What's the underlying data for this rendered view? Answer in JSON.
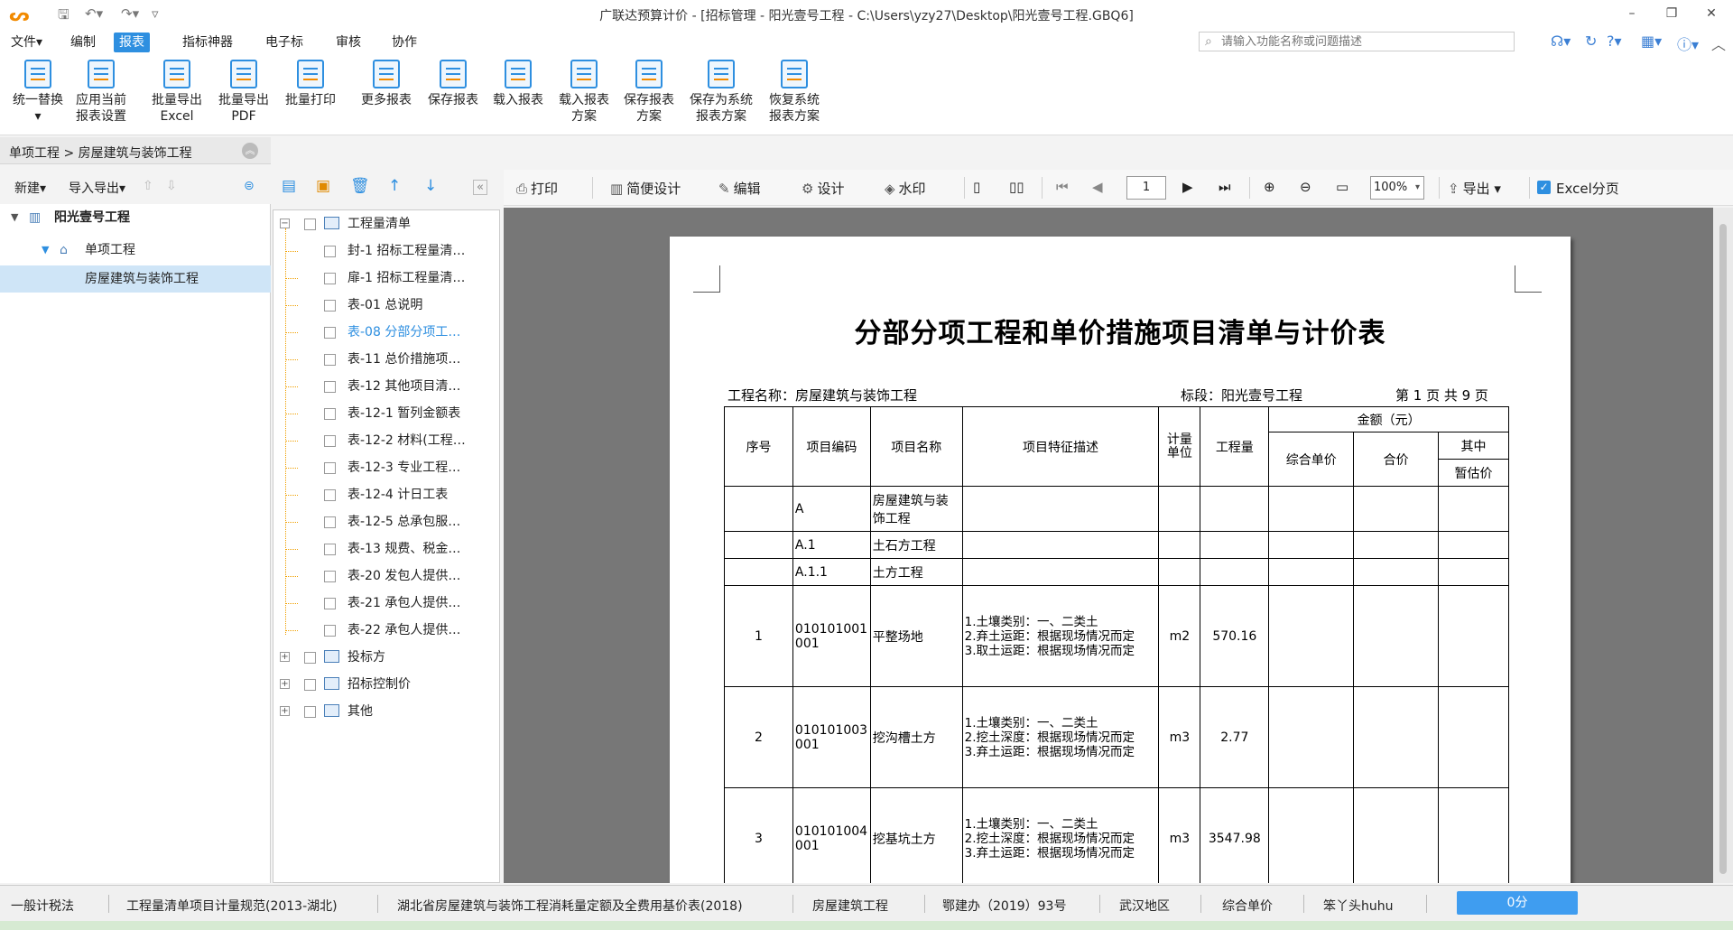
{
  "window": {
    "title": "广联达预算计价 - [招标管理 - 阳光壹号工程 - C:\\Users\\yzy27\\Desktop\\阳光壹号工程.GBQ6]",
    "minimize": "–",
    "restore": "❐",
    "close": "✕"
  },
  "menu": {
    "items": [
      "文件▾",
      "编制",
      "报表",
      "指标神器",
      "电子标",
      "审核",
      "协作"
    ],
    "active_index": 2
  },
  "search": {
    "placeholder": "请输入功能名称或问题描述"
  },
  "ribbon": {
    "buttons": [
      {
        "l1": "统一替换",
        "l2": "▾"
      },
      {
        "l1": "应用当前",
        "l2": "报表设置"
      },
      {
        "l1": "批量导出",
        "l2": "Excel"
      },
      {
        "l1": "批量导出",
        "l2": "PDF"
      },
      {
        "l1": "批量打印",
        "l2": ""
      },
      {
        "l1": "更多报表",
        "l2": ""
      },
      {
        "l1": "保存报表",
        "l2": ""
      },
      {
        "l1": "载入报表",
        "l2": ""
      },
      {
        "l1": "载入报表",
        "l2": "方案"
      },
      {
        "l1": "保存报表",
        "l2": "方案"
      },
      {
        "l1": "保存为系统",
        "l2": "报表方案"
      },
      {
        "l1": "恢复系统",
        "l2": "报表方案"
      }
    ]
  },
  "breadcrumb": "单项工程 > 房屋建筑与装饰工程",
  "left_toolbar": {
    "new": "新建▾",
    "import_export": "导入导出▾"
  },
  "left_tree": {
    "root": "阳光壹号工程",
    "child": "单项工程",
    "leaf": "房屋建筑与装饰工程"
  },
  "report_tree": {
    "group1": "工程量清单",
    "items": [
      "封-1 招标工程量清…",
      "扉-1 招标工程量清…",
      "表-01 总说明",
      "表-08 分部分项工…",
      "表-11 总价措施项…",
      "表-12 其他项目清…",
      "表-12-1 暂列金额表",
      "表-12-2 材料(工程…",
      "表-12-3 专业工程…",
      "表-12-4 计日工表",
      "表-12-5 总承包服…",
      "表-13 规费、税金…",
      "表-20 发包人提供…",
      "表-21 承包人提供…",
      "表-22 承包人提供…"
    ],
    "selected_index": 3,
    "groups": [
      "投标方",
      "招标控制价",
      "其他"
    ]
  },
  "viewer_toolbar": {
    "print": "打印",
    "easy_design": "简便设计",
    "edit": "编辑",
    "design": "设计",
    "watermark": "水印",
    "page": "1",
    "zoom": "100%",
    "export": "导出",
    "excel_paging": "Excel分页"
  },
  "report": {
    "title": "分部分项工程和单价措施项目清单与计价表",
    "project_name": "工程名称：房屋建筑与装饰工程",
    "section": "标段：阳光壹号工程",
    "page_info": "第 1 页  共 9 页",
    "headers": {
      "seq": "序号",
      "code": "项目编码",
      "name": "项目名称",
      "desc": "项目特征描述",
      "unit": "计量单位",
      "qty": "工程量",
      "amount": "金额（元）",
      "unit_price": "综合单价",
      "total": "合价",
      "of_which": "其中",
      "provisional": "暂估价"
    },
    "rows": [
      {
        "seq": "",
        "code": "A",
        "name": "房屋建筑与装饰工程",
        "desc": "",
        "unit": "",
        "qty": ""
      },
      {
        "seq": "",
        "code": "A.1",
        "name": "土石方工程",
        "desc": "",
        "unit": "",
        "qty": ""
      },
      {
        "seq": "",
        "code": "A.1.1",
        "name": "土方工程",
        "desc": "",
        "unit": "",
        "qty": ""
      },
      {
        "seq": "1",
        "code": "010101001001",
        "name": "平整场地",
        "desc": "1.土壤类别：一、二类土\n2.弃土运距：根据现场情况而定\n3.取土运距：根据现场情况而定",
        "unit": "m2",
        "qty": "570.16"
      },
      {
        "seq": "2",
        "code": "010101003001",
        "name": "挖沟槽土方",
        "desc": "1.土壤类别：一、二类土\n2.挖土深度：根据现场情况而定\n3.弃土运距：根据现场情况而定",
        "unit": "m3",
        "qty": "2.77"
      },
      {
        "seq": "3",
        "code": "010101004001",
        "name": "挖基坑土方",
        "desc": "1.土壤类别：一、二类土\n2.挖土深度：根据现场情况而定\n3.弃土运距：根据现场情况而定",
        "unit": "m3",
        "qty": "3547.98"
      }
    ]
  },
  "status": {
    "items": [
      "一般计税法",
      "工程量清单项目计量规范(2013-湖北)",
      "湖北省房屋建筑与装饰工程消耗量定额及全费用基价表(2018)",
      "房屋建筑工程",
      "鄂建办（2019）93号",
      "武汉地区",
      "综合单价",
      "笨丫头huhu"
    ],
    "score": "0分"
  },
  "colors": {
    "accent": "#2e8fe0",
    "brand": "#f28a00",
    "viewer_bg": "#777777"
  }
}
